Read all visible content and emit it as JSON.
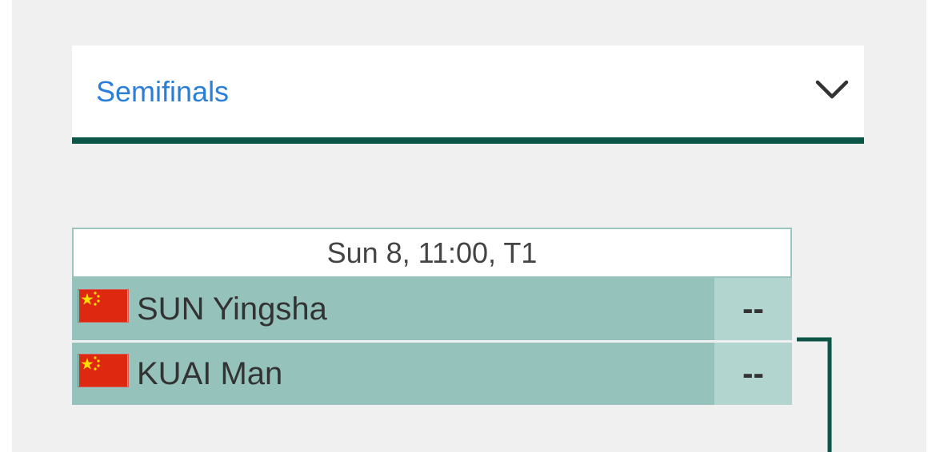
{
  "round_selector": {
    "label": "Semifinals",
    "icon": "chevron-down-icon"
  },
  "match": {
    "header": "Sun 8, 11:00, T1",
    "players": [
      {
        "name": "SUN Yingsha",
        "country_flag": "china-flag-icon",
        "score": "--"
      },
      {
        "name": "KUAI Man",
        "country_flag": "china-flag-icon",
        "score": "--"
      }
    ]
  },
  "colors": {
    "accent": "#0d5546",
    "link": "#2b7fd6",
    "row_bg": "#95c3bb",
    "score_bg": "#b2d5cf",
    "page_bg": "#f0f0f0"
  }
}
